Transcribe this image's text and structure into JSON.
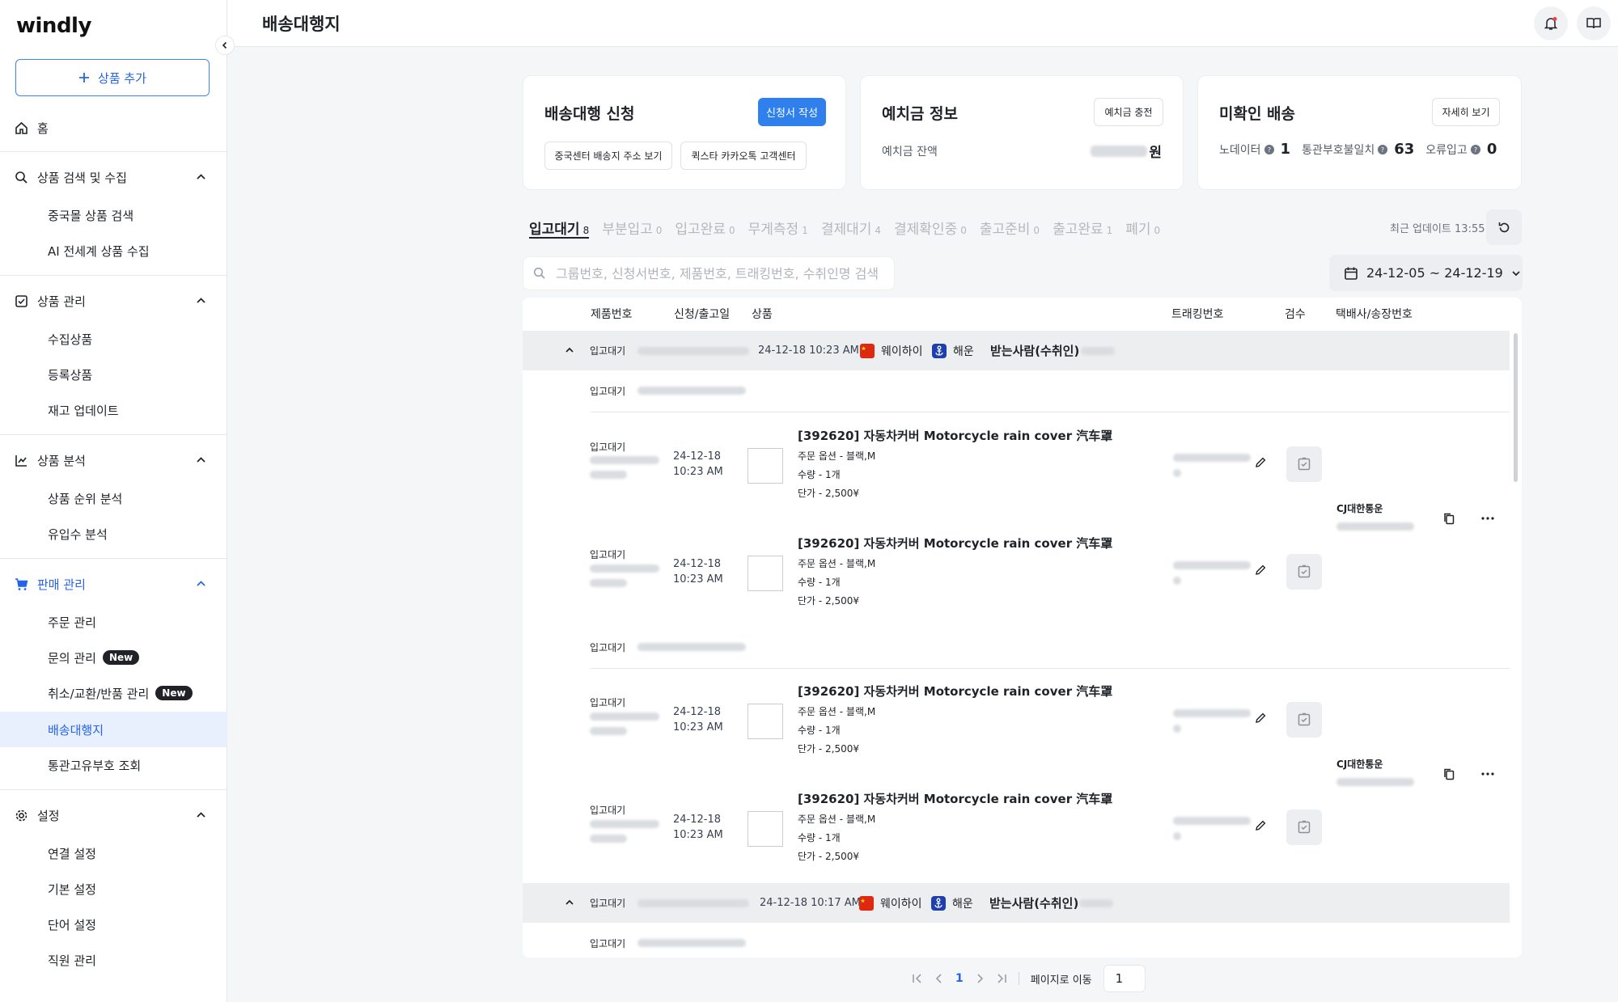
{
  "app": {
    "logo": "windly"
  },
  "sidebar": {
    "add_button": "상품 추가",
    "home": "홈",
    "sections": [
      {
        "label": "상품 검색 및 수집",
        "items": [
          "중국몰 상품 검색",
          "AI 전세계 상품 수집"
        ]
      },
      {
        "label": "상품 관리",
        "items": [
          "수집상품",
          "등록상품",
          "재고 업데이트"
        ]
      },
      {
        "label": "상품 분석",
        "items": [
          "상품 순위 분석",
          "유입수 분석"
        ]
      },
      {
        "label": "판매 관리",
        "items": [
          "주문 관리",
          "문의 관리",
          "취소/교환/반품 관리",
          "배송대행지",
          "통관고유부호 조회"
        ]
      },
      {
        "label": "설정",
        "items": [
          "연결 설정",
          "기본 설정",
          "단어 설정",
          "직원 관리"
        ]
      }
    ],
    "badge_new": "New",
    "active_item": "배송대행지"
  },
  "header": {
    "title": "배송대행지"
  },
  "cards": {
    "apply": {
      "title": "배송대행 신청",
      "primary_button": "신청서 작성",
      "btn1": "중국센터 배송지 주소 보기",
      "btn2": "퀵스타 카카오톡 고객센터"
    },
    "deposit": {
      "title": "예치금 정보",
      "button": "예치금 충전",
      "balance_label": "예치금 잔액",
      "balance_suffix": "원"
    },
    "unconfirmed": {
      "title": "미확인 배송",
      "button": "자세히 보기",
      "stats": [
        {
          "label": "노데이터",
          "value": "1"
        },
        {
          "label": "통관부호불일치",
          "value": "63"
        },
        {
          "label": "오류입고",
          "value": "0"
        }
      ]
    }
  },
  "tabs": [
    {
      "label": "입고대기",
      "count": "8"
    },
    {
      "label": "부분입고",
      "count": "0"
    },
    {
      "label": "입고완료",
      "count": "0"
    },
    {
      "label": "무게측정",
      "count": "1"
    },
    {
      "label": "결제대기",
      "count": "4"
    },
    {
      "label": "결제확인중",
      "count": "0"
    },
    {
      "label": "출고준비",
      "count": "0"
    },
    {
      "label": "출고완료",
      "count": "1"
    },
    {
      "label": "폐기",
      "count": "0"
    }
  ],
  "last_update": "최근 업데이트 13:55",
  "search": {
    "placeholder": "그룹번호, 신청서번호, 제품번호, 트래킹번호, 수취인명 검색"
  },
  "date_range": "24-12-05 ~ 24-12-19",
  "table": {
    "headers": [
      "제품번호",
      "신청/출고일",
      "상품",
      "트래킹번호",
      "검수",
      "택배사/송장번호"
    ],
    "groups": [
      {
        "status": "입고대기",
        "datetime": "24-12-18 10:23 AM",
        "carrier": "웨이하이",
        "shipping": "해운",
        "receiver_label": "받는사람(수취인)",
        "sub_status": "입고대기",
        "courier": "CJ대한통운"
      },
      {
        "status": "입고대기",
        "datetime": "24-12-18 10:17 AM",
        "carrier": "웨이하이",
        "shipping": "해운",
        "receiver_label": "받는사람(수취인)",
        "sub_status": "입고대기"
      }
    ],
    "sub2": {
      "status": "입고대기",
      "courier": "CJ대한통운"
    },
    "item": {
      "status": "입고대기",
      "date": "24-12-18",
      "time": "10:23 AM",
      "name": "[392620] 자동차커버 Motorcycle rain cover 汽车罩",
      "option": "주문 옵션 - 블랙,M",
      "qty": "수량 - 1개",
      "price": "단가 - 2,500¥"
    }
  },
  "pager": {
    "current": "1",
    "goto_label": "페이지로 이동",
    "input_value": "1"
  }
}
